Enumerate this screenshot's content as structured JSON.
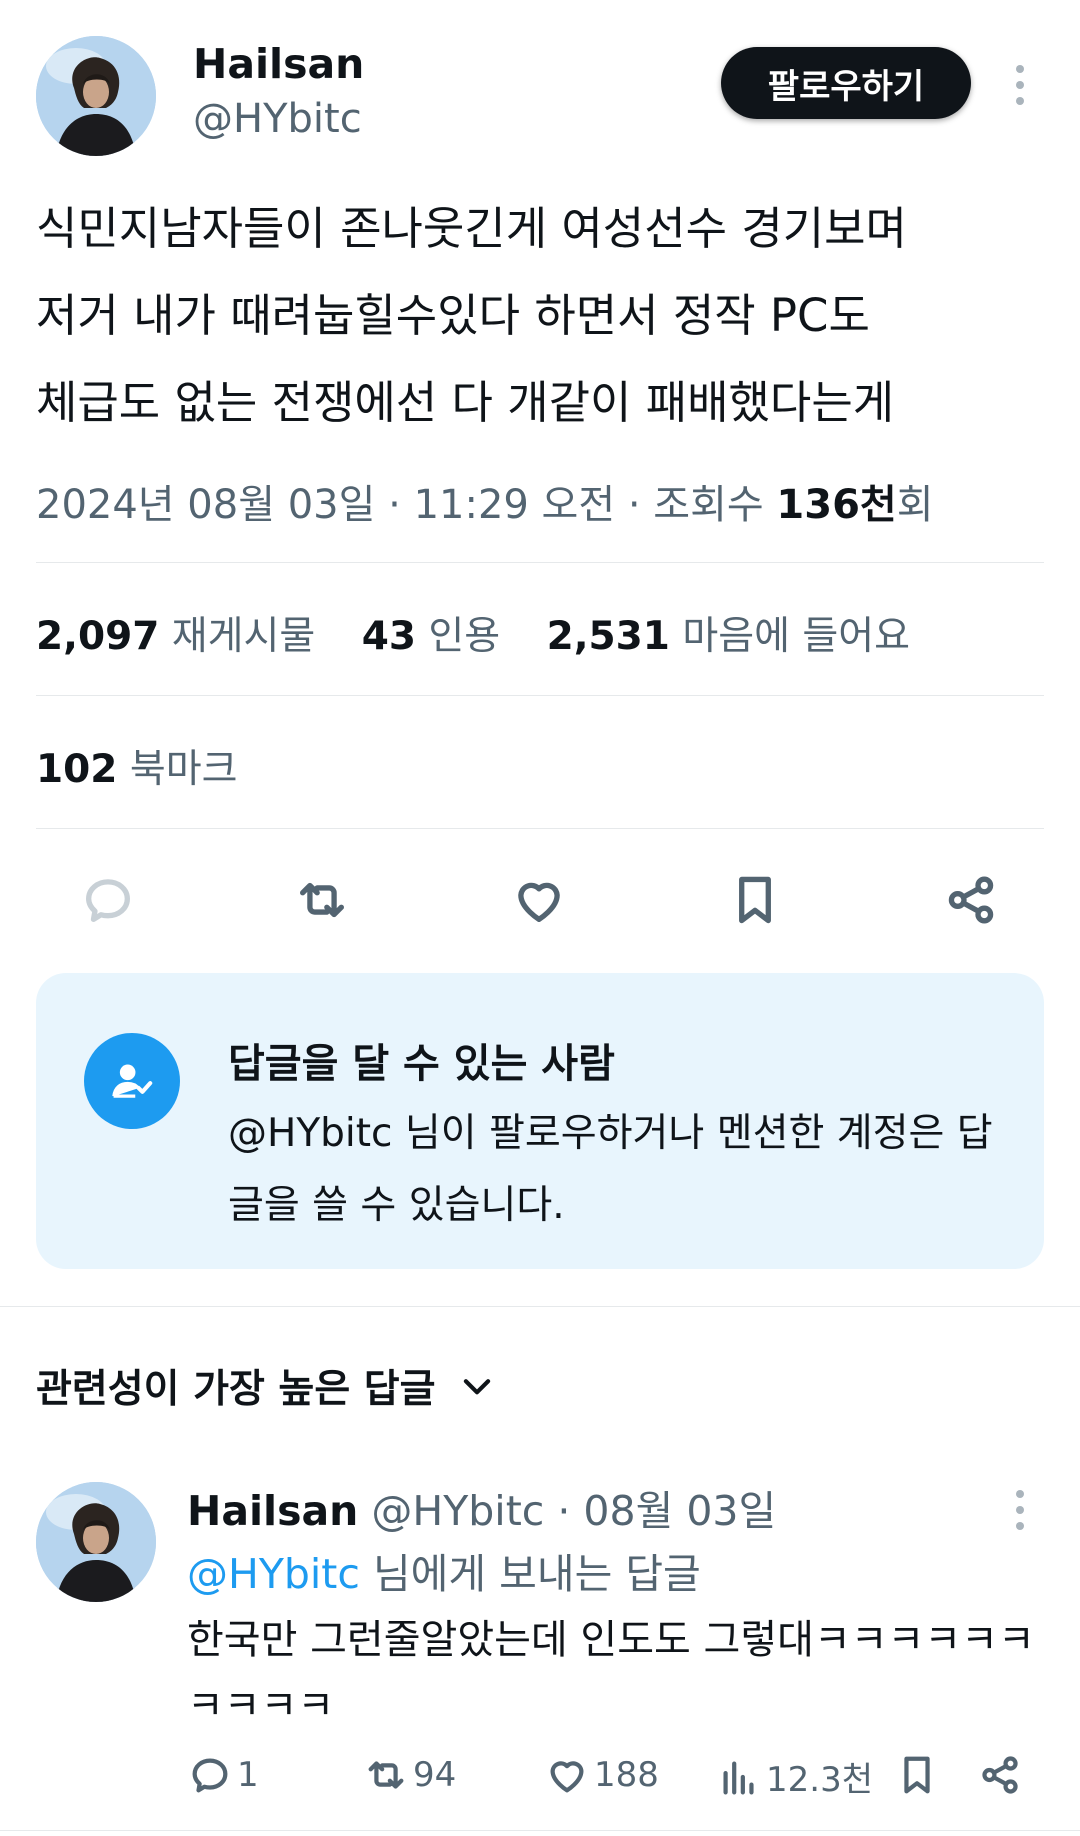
{
  "author": {
    "name": "Hailsan",
    "handle": "@HYbitc",
    "follow_label": "팔로우하기"
  },
  "tweet": {
    "text": "식민지남자들이 존나웃긴게 여성선수 경기보며\n저거 내가 때려눕힐수있다 하면서 정작 PC도\n체급도 없는 전쟁에선 다 개같이 패배했다는게",
    "date_time": "2024년 08월 03일 · 11:29 오전 · 조회수 ",
    "views_value": "136천",
    "views_suffix": "회"
  },
  "stats": {
    "retweets_count": "2,097",
    "retweets_label": "재게시물",
    "quotes_count": "43",
    "quotes_label": "인용",
    "likes_count": "2,531",
    "likes_label": "마음에 들어요",
    "bookmarks_count": "102",
    "bookmarks_label": "북마크"
  },
  "action_icons": [
    "reply-icon",
    "retweet-icon",
    "like-icon",
    "bookmark-icon",
    "share-icon"
  ],
  "reply_restriction": {
    "title": "답글을 달 수 있는 사람",
    "body": "@HYbitc 님이 팔로우하거나 멘션한 계정은 답글을 쓸 수 있습니다."
  },
  "replies_sort": {
    "label": "관련성이 가장 높은 답글"
  },
  "reply": {
    "name": "Hailsan",
    "handle_date": "@HYbitc · 08월 03일",
    "replying_to_mention": "@HYbitc",
    "replying_to_suffix": " 님에게 보내는 답글",
    "text": "한국만 그런줄알았는데 인도도 그렇대ㅋㅋㅋㅋㅋㅋㅋㅋㅋㅋ",
    "reply_count": "1",
    "retweet_count": "94",
    "like_count": "188",
    "view_count": "12.3천"
  },
  "colors": {
    "accent": "#1d9bf0",
    "text": "#0f1419",
    "secondary": "#536471",
    "reply_box_bg": "#e8f5fd",
    "button_bg": "#0f1419"
  }
}
